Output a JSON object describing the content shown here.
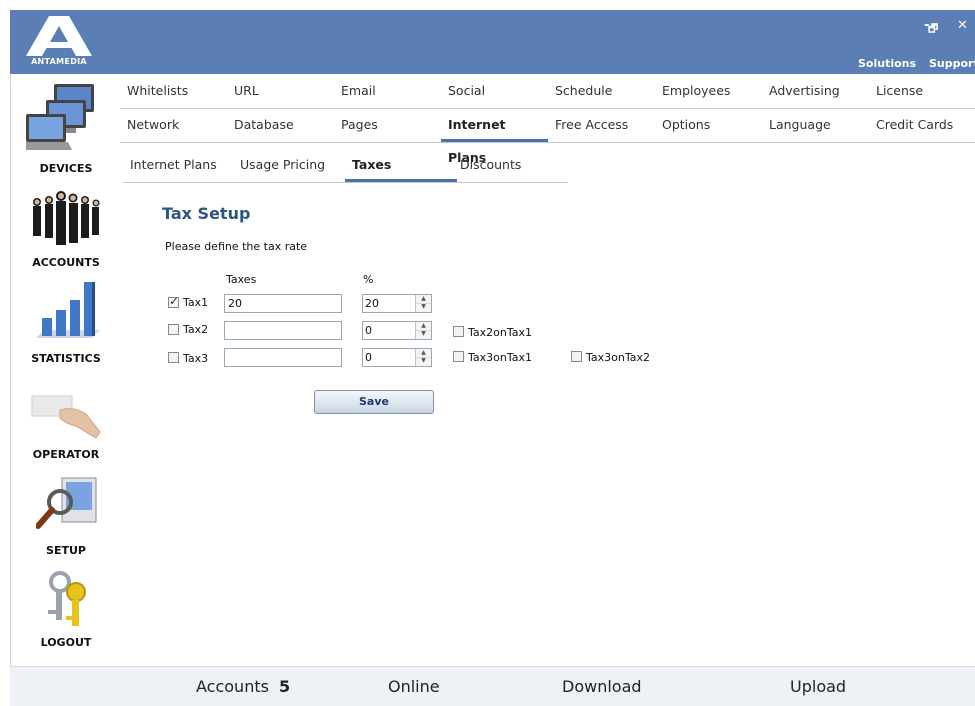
{
  "app": {
    "logo_text": "ANTAMEDIA"
  },
  "window_controls": {
    "minimize": "-",
    "restore": "🗗",
    "close": "✕"
  },
  "header_links": {
    "solutions": "Solutions",
    "support": "Support"
  },
  "sidebar": {
    "items": [
      {
        "label": "DEVICES",
        "icon": "devices-icon"
      },
      {
        "label": "ACCOUNTS",
        "icon": "accounts-icon"
      },
      {
        "label": "STATISTICS",
        "icon": "statistics-icon"
      },
      {
        "label": "OPERATOR",
        "icon": "operator-icon"
      },
      {
        "label": "SETUP",
        "icon": "setup-icon"
      },
      {
        "label": "LOGOUT",
        "icon": "keys-icon"
      }
    ]
  },
  "menu": {
    "row1": [
      "Whitelists",
      "URL",
      "Email",
      "Social",
      "Schedule",
      "Employees",
      "Advertising",
      "License"
    ],
    "row2": [
      "Network",
      "Database",
      "Pages",
      "Internet Plans",
      "Free Access",
      "Options",
      "Language",
      "Credit Cards"
    ],
    "active": "Internet Plans"
  },
  "subtabs": {
    "items": [
      "Internet Plans",
      "Usage Pricing",
      "Taxes",
      "Discounts"
    ],
    "active": "Taxes"
  },
  "tax_setup": {
    "title": "Tax Setup",
    "description": "Please define the tax rate",
    "col_taxes": "Taxes",
    "col_percent": "%",
    "rows": [
      {
        "label": "Tax1",
        "checked": true,
        "taxes": "20",
        "percent": "20"
      },
      {
        "label": "Tax2",
        "checked": false,
        "taxes": "",
        "percent": "0",
        "extra": [
          "Tax2onTax1"
        ]
      },
      {
        "label": "Tax3",
        "checked": false,
        "taxes": "",
        "percent": "0",
        "extra": [
          "Tax3onTax1",
          "Tax3onTax2"
        ]
      }
    ],
    "save_label": "Save"
  },
  "footer": {
    "accounts_label": "Accounts",
    "accounts_value": "5",
    "online_label": "Online",
    "download_label": "Download",
    "upload_label": "Upload"
  },
  "colors": {
    "header": "#5b7fb4",
    "accent": "#4a74ad",
    "title": "#2e5483"
  }
}
